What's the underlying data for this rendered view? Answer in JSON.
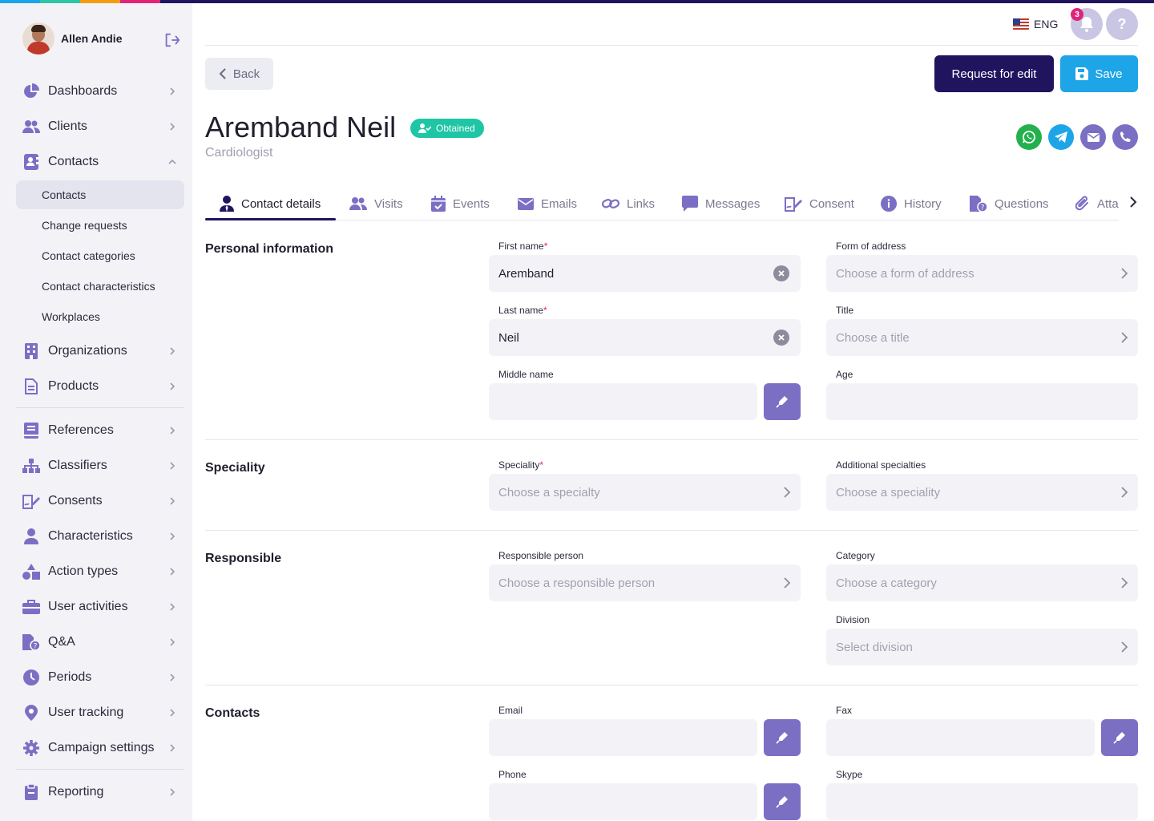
{
  "colors": {
    "strip": [
      "#1ea5e8",
      "#2ec4a5",
      "#f39c12",
      "#e0247a",
      "#21145f"
    ],
    "accent_dark": "#21145f",
    "accent_blue": "#1ea5e8",
    "icon_purple": "#7b6fc4",
    "status_green": "#1ec6a5"
  },
  "user": {
    "name": "Allen Andie"
  },
  "sidebar": {
    "items": [
      {
        "label": "Dashboards",
        "icon": "pie-chart-icon"
      },
      {
        "label": "Clients",
        "icon": "users-icon"
      },
      {
        "label": "Contacts",
        "icon": "address-book-icon",
        "expanded": true,
        "children": [
          "Contacts",
          "Change requests",
          "Contact categories",
          "Contact characteristics",
          "Workplaces"
        ]
      },
      {
        "label": "Organizations",
        "icon": "building-icon"
      },
      {
        "label": "Products",
        "icon": "document-icon"
      },
      {
        "label": "References",
        "icon": "book-icon"
      },
      {
        "label": "Classifiers",
        "icon": "hierarchy-icon"
      },
      {
        "label": "Consents",
        "icon": "signature-icon"
      },
      {
        "label": "Characteristics",
        "icon": "person-icon"
      },
      {
        "label": "Action types",
        "icon": "shapes-icon"
      },
      {
        "label": "User activities",
        "icon": "briefcase-icon"
      },
      {
        "label": "Q&A",
        "icon": "question-file-icon"
      },
      {
        "label": "Periods",
        "icon": "clock-icon"
      },
      {
        "label": "User tracking",
        "icon": "location-pin-icon"
      },
      {
        "label": "Campaign settings",
        "icon": "gear-icon"
      },
      {
        "label": "Reporting",
        "icon": "clipboard-icon"
      }
    ]
  },
  "topbar": {
    "language": "ENG",
    "notifications_count": "3",
    "help": "?"
  },
  "toolbar": {
    "back_label": "Back",
    "request_label": "Request for edit",
    "save_label": "Save"
  },
  "contact": {
    "name": "Aremband Neil",
    "status": "Obtained",
    "subtitle": "Cardiologist"
  },
  "tabs": [
    "Contact details",
    "Visits",
    "Events",
    "Emails",
    "Links",
    "Messages",
    "Consent",
    "History",
    "Questions",
    "Attachments"
  ],
  "sections": {
    "personal": {
      "title": "Personal information",
      "first_name_label": "First name",
      "first_name_value": "Aremband",
      "last_name_label": "Last name",
      "last_name_value": "Neil",
      "middle_name_label": "Middle name",
      "form_of_address_label": "Form of address",
      "form_of_address_placeholder": "Choose a form of address",
      "title_label": "Title",
      "title_placeholder": "Choose a title",
      "age_label": "Age"
    },
    "speciality": {
      "title": "Speciality",
      "speciality_label": "Speciality",
      "speciality_placeholder": "Choose a specialty",
      "additional_label": "Additional specialties",
      "additional_placeholder": "Choose a speciality"
    },
    "responsible": {
      "title": "Responsible",
      "person_label": "Responsible person",
      "person_placeholder": "Choose a responsible person",
      "category_label": "Category",
      "category_placeholder": "Choose a category",
      "division_label": "Division",
      "division_placeholder": "Select division"
    },
    "contacts": {
      "title": "Contacts",
      "email_label": "Email",
      "fax_label": "Fax",
      "phone_label": "Phone",
      "skype_label": "Skype"
    }
  },
  "required_mark": "*"
}
